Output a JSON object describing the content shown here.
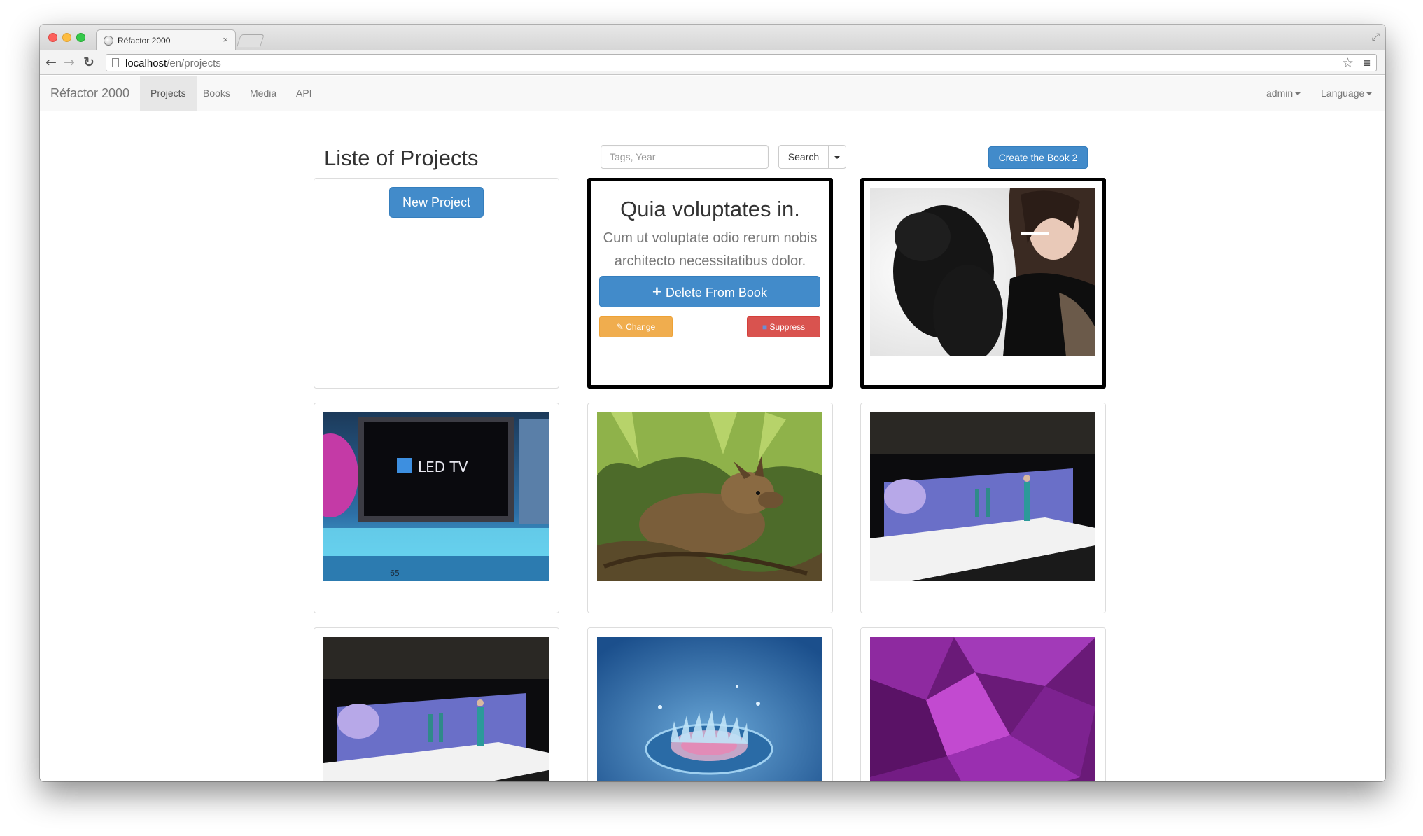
{
  "browser": {
    "tab_title": "Réfactor 2000",
    "tab_close": "×",
    "url_host": "localhost",
    "url_path": "/en/projects",
    "back_icon": "←",
    "forward_icon": "→",
    "reload_icon": "↻",
    "star_icon": "☆",
    "menu_icon": "≡",
    "fullscreen_icon": "⤢"
  },
  "navbar": {
    "brand": "Réfactor 2000",
    "links": [
      {
        "label": "Projects",
        "active": true
      },
      {
        "label": "Books",
        "active": false
      },
      {
        "label": "Media",
        "active": false
      },
      {
        "label": "API",
        "active": false
      }
    ],
    "user_menu": "admin",
    "language_menu": "Language"
  },
  "page": {
    "title": "Liste of Projects",
    "search_placeholder": "Tags, Year",
    "search_button": "Search",
    "create_book_button": "Create the Book 2"
  },
  "cards": {
    "new_project_button": "New Project",
    "book": {
      "title": "Quia voluptates in.",
      "description": "Cum ut voluptate odio rerum nobis architecto necessitatibus dolor.",
      "delete_button": "Delete From Book",
      "change_button": "Change",
      "suppress_button": "Suppress"
    },
    "images": [
      {
        "subject": "fashion-portrait"
      },
      {
        "subject": "led-tv-stage",
        "overlay_text": "LED TV",
        "small_text": "65"
      },
      {
        "subject": "deer-in-forest"
      },
      {
        "subject": "runway-show"
      },
      {
        "subject": "runway-show"
      },
      {
        "subject": "water-drop"
      },
      {
        "subject": "purple-crystals"
      }
    ]
  },
  "colors": {
    "primary": "#428bca",
    "warning": "#f0ad4e",
    "danger": "#d9534f",
    "navbar_bg": "#f8f8f8"
  }
}
